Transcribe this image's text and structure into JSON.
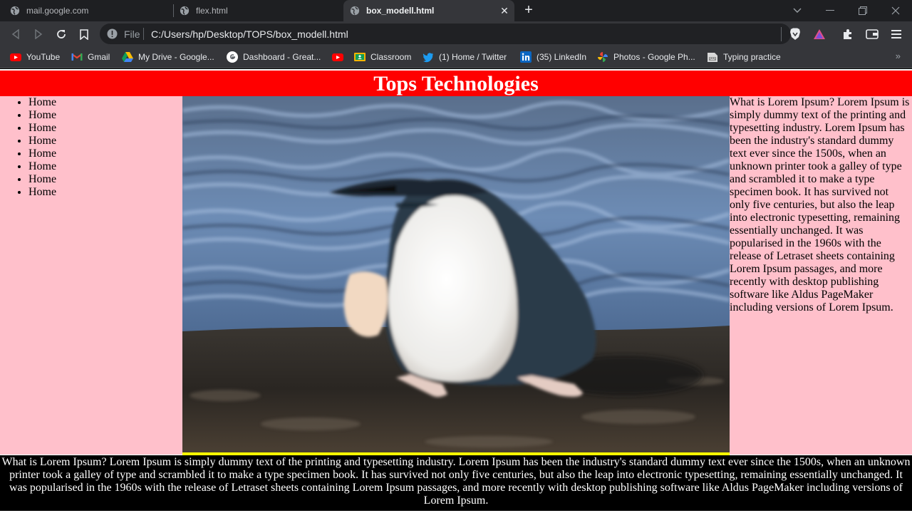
{
  "tabs": [
    {
      "title": "mail.google.com",
      "active": false
    },
    {
      "title": "flex.html",
      "active": false
    },
    {
      "title": "box_modell.html",
      "active": true
    }
  ],
  "omnibox": {
    "scheme_label": "File",
    "url": "C:/Users/hp/Desktop/TOPS/box_modell.html"
  },
  "bookmarks": [
    {
      "label": "YouTube",
      "icon": "youtube-icon"
    },
    {
      "label": "Gmail",
      "icon": "gmail-icon"
    },
    {
      "label": "My Drive - Google...",
      "icon": "drive-icon"
    },
    {
      "label": "Dashboard - Great...",
      "icon": "google-icon"
    },
    {
      "label": "",
      "icon": "youtube-icon"
    },
    {
      "label": "Classroom",
      "icon": "classroom-icon"
    },
    {
      "label": "(1) Home / Twitter",
      "icon": "twitter-icon"
    },
    {
      "label": "(35) LinkedIn",
      "icon": "linkedin-icon"
    },
    {
      "label": "Photos - Google Ph...",
      "icon": "photos-icon"
    },
    {
      "label": "Typing practice",
      "icon": "typing-icon"
    }
  ],
  "page": {
    "header_title": "Tops Technologies",
    "nav_items": [
      "Home",
      "Home",
      "Home",
      "Home",
      "Home",
      "Home",
      "Home",
      "Home"
    ],
    "aside_text": "What is Lorem Ipsum? Lorem Ipsum is simply dummy text of the printing and typesetting industry. Lorem Ipsum has been the industry's standard dummy text ever since the 1500s, when an unknown printer took a galley of type and scrambled it to make a type specimen book. It has survived not only five centuries, but also the leap into electronic typesetting, remaining essentially unchanged. It was popularised in the 1960s with the release of Letraset sheets containing Lorem Ipsum passages, and more recently with desktop publishing software like Aldus PageMaker including versions of Lorem Ipsum.",
    "footer_text": "What is Lorem Ipsum? Lorem Ipsum is simply dummy text of the printing and typesetting industry. Lorem Ipsum has been the industry's standard dummy text ever since the 1500s, when an unknown printer took a galley of type and scrambled it to make a type specimen book. It has survived not only five centuries, but also the leap into electronic typesetting, remaining essentially unchanged. It was popularised in the 1960s with the release of Letraset sheets containing Lorem Ipsum passages, and more recently with desktop publishing software like Aldus PageMaker including versions of Lorem Ipsum."
  },
  "colors": {
    "header_bg": "#ff0000",
    "side_bg": "#ffc0cb",
    "image_border": "#ffff00",
    "footer_bg": "#000000"
  }
}
